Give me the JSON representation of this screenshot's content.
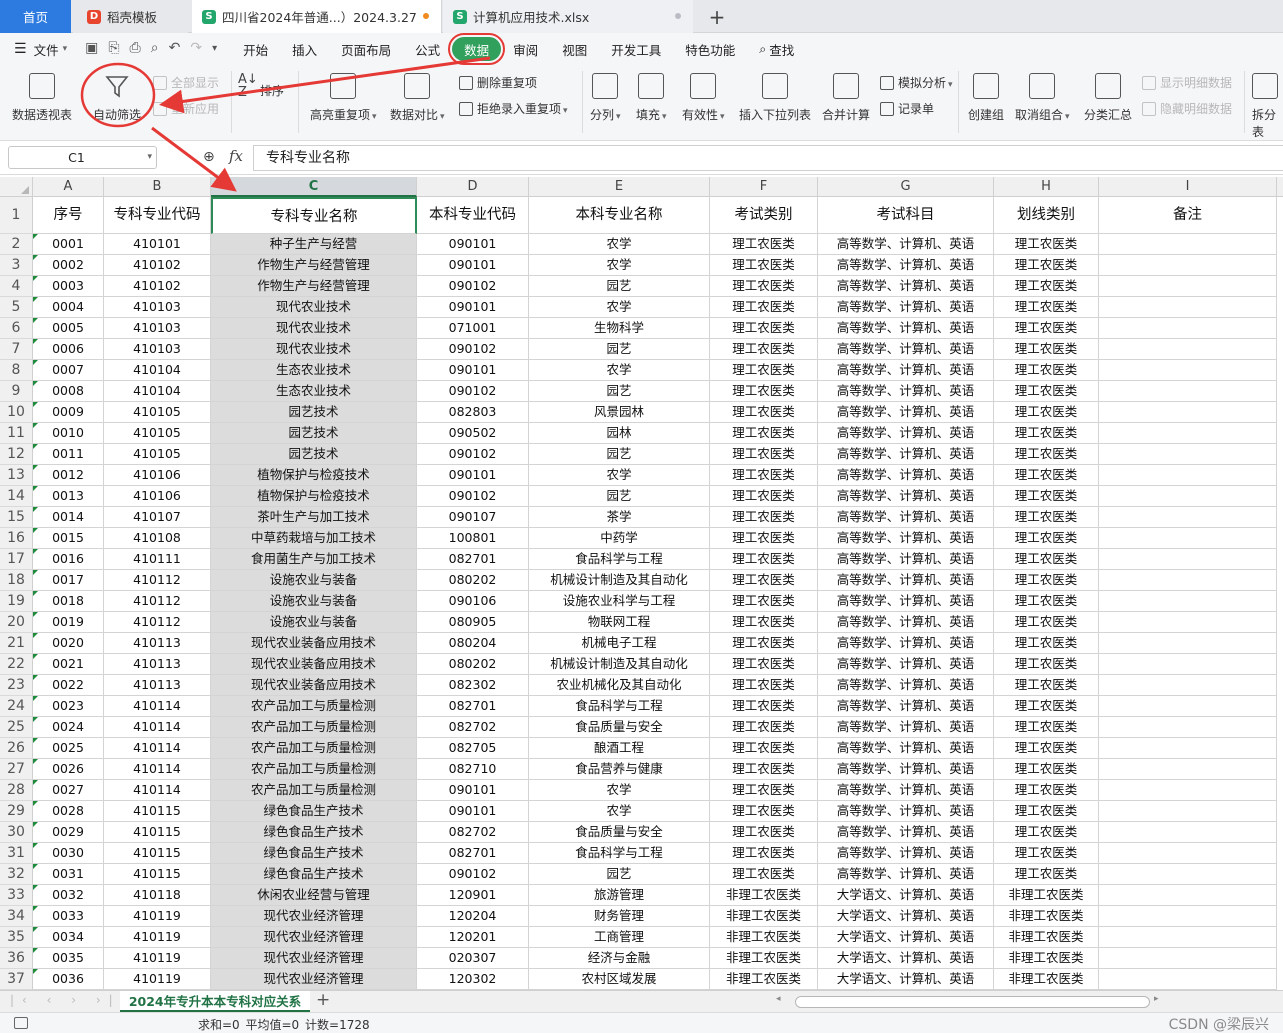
{
  "tabs": {
    "home": "首页",
    "t1": "稻壳模板",
    "t2": "四川省2024年普通...）2024.3.27",
    "t3": "计算机应用技术.xlsx",
    "plus": "+"
  },
  "menu": {
    "file": "文件",
    "tabs": [
      "开始",
      "插入",
      "页面布局",
      "公式",
      "数据",
      "审阅",
      "视图",
      "开发工具",
      "特色功能"
    ],
    "active_index": 4,
    "search": "查找"
  },
  "ribbon": {
    "pivot": "数据透视表",
    "autofilter": "自动筛选",
    "show_all": "全部显示",
    "reapply": "重新应用",
    "sort": "排序",
    "highlight_dup": "高亮重复项",
    "compare": "数据对比",
    "delete_dup": "删除重复项",
    "reject_dup": "拒绝录入重复项",
    "split": "分列",
    "fill": "填充",
    "validity": "有效性",
    "dropdown": "插入下拉列表",
    "consolidate": "合并计算",
    "simulate": "模拟分析",
    "record": "记录单",
    "group": "创建组",
    "ungroup": "取消组合",
    "subtotal": "分类汇总",
    "show_detail": "显示明细数据",
    "hide_detail": "隐藏明细数据",
    "split_table": "拆分表"
  },
  "formula_bar": {
    "name_box": "C1",
    "fx": "fx",
    "content": "专科专业名称"
  },
  "columns": [
    "A",
    "B",
    "C",
    "D",
    "E",
    "F",
    "G",
    "H",
    "I"
  ],
  "headers": [
    "序号",
    "专科专业代码",
    "专科专业名称",
    "本科专业代码",
    "本科专业名称",
    "考试类别",
    "考试科目",
    "划线类别",
    "备注"
  ],
  "rows": [
    [
      "0001",
      "410101",
      "种子生产与经营",
      "090101",
      "农学",
      "理工农医类",
      "高等数学、计算机、英语",
      "理工农医类",
      ""
    ],
    [
      "0002",
      "410102",
      "作物生产与经营管理",
      "090101",
      "农学",
      "理工农医类",
      "高等数学、计算机、英语",
      "理工农医类",
      ""
    ],
    [
      "0003",
      "410102",
      "作物生产与经营管理",
      "090102",
      "园艺",
      "理工农医类",
      "高等数学、计算机、英语",
      "理工农医类",
      ""
    ],
    [
      "0004",
      "410103",
      "现代农业技术",
      "090101",
      "农学",
      "理工农医类",
      "高等数学、计算机、英语",
      "理工农医类",
      ""
    ],
    [
      "0005",
      "410103",
      "现代农业技术",
      "071001",
      "生物科学",
      "理工农医类",
      "高等数学、计算机、英语",
      "理工农医类",
      ""
    ],
    [
      "0006",
      "410103",
      "现代农业技术",
      "090102",
      "园艺",
      "理工农医类",
      "高等数学、计算机、英语",
      "理工农医类",
      ""
    ],
    [
      "0007",
      "410104",
      "生态农业技术",
      "090101",
      "农学",
      "理工农医类",
      "高等数学、计算机、英语",
      "理工农医类",
      ""
    ],
    [
      "0008",
      "410104",
      "生态农业技术",
      "090102",
      "园艺",
      "理工农医类",
      "高等数学、计算机、英语",
      "理工农医类",
      ""
    ],
    [
      "0009",
      "410105",
      "园艺技术",
      "082803",
      "风景园林",
      "理工农医类",
      "高等数学、计算机、英语",
      "理工农医类",
      ""
    ],
    [
      "0010",
      "410105",
      "园艺技术",
      "090502",
      "园林",
      "理工农医类",
      "高等数学、计算机、英语",
      "理工农医类",
      ""
    ],
    [
      "0011",
      "410105",
      "园艺技术",
      "090102",
      "园艺",
      "理工农医类",
      "高等数学、计算机、英语",
      "理工农医类",
      ""
    ],
    [
      "0012",
      "410106",
      "植物保护与检疫技术",
      "090101",
      "农学",
      "理工农医类",
      "高等数学、计算机、英语",
      "理工农医类",
      ""
    ],
    [
      "0013",
      "410106",
      "植物保护与检疫技术",
      "090102",
      "园艺",
      "理工农医类",
      "高等数学、计算机、英语",
      "理工农医类",
      ""
    ],
    [
      "0014",
      "410107",
      "茶叶生产与加工技术",
      "090107",
      "茶学",
      "理工农医类",
      "高等数学、计算机、英语",
      "理工农医类",
      ""
    ],
    [
      "0015",
      "410108",
      "中草药栽培与加工技术",
      "100801",
      "中药学",
      "理工农医类",
      "高等数学、计算机、英语",
      "理工农医类",
      ""
    ],
    [
      "0016",
      "410111",
      "食用菌生产与加工技术",
      "082701",
      "食品科学与工程",
      "理工农医类",
      "高等数学、计算机、英语",
      "理工农医类",
      ""
    ],
    [
      "0017",
      "410112",
      "设施农业与装备",
      "080202",
      "机械设计制造及其自动化",
      "理工农医类",
      "高等数学、计算机、英语",
      "理工农医类",
      ""
    ],
    [
      "0018",
      "410112",
      "设施农业与装备",
      "090106",
      "设施农业科学与工程",
      "理工农医类",
      "高等数学、计算机、英语",
      "理工农医类",
      ""
    ],
    [
      "0019",
      "410112",
      "设施农业与装备",
      "080905",
      "物联网工程",
      "理工农医类",
      "高等数学、计算机、英语",
      "理工农医类",
      ""
    ],
    [
      "0020",
      "410113",
      "现代农业装备应用技术",
      "080204",
      "机械电子工程",
      "理工农医类",
      "高等数学、计算机、英语",
      "理工农医类",
      ""
    ],
    [
      "0021",
      "410113",
      "现代农业装备应用技术",
      "080202",
      "机械设计制造及其自动化",
      "理工农医类",
      "高等数学、计算机、英语",
      "理工农医类",
      ""
    ],
    [
      "0022",
      "410113",
      "现代农业装备应用技术",
      "082302",
      "农业机械化及其自动化",
      "理工农医类",
      "高等数学、计算机、英语",
      "理工农医类",
      ""
    ],
    [
      "0023",
      "410114",
      "农产品加工与质量检测",
      "082701",
      "食品科学与工程",
      "理工农医类",
      "高等数学、计算机、英语",
      "理工农医类",
      ""
    ],
    [
      "0024",
      "410114",
      "农产品加工与质量检测",
      "082702",
      "食品质量与安全",
      "理工农医类",
      "高等数学、计算机、英语",
      "理工农医类",
      ""
    ],
    [
      "0025",
      "410114",
      "农产品加工与质量检测",
      "082705",
      "酿酒工程",
      "理工农医类",
      "高等数学、计算机、英语",
      "理工农医类",
      ""
    ],
    [
      "0026",
      "410114",
      "农产品加工与质量检测",
      "082710",
      "食品营养与健康",
      "理工农医类",
      "高等数学、计算机、英语",
      "理工农医类",
      ""
    ],
    [
      "0027",
      "410114",
      "农产品加工与质量检测",
      "090101",
      "农学",
      "理工农医类",
      "高等数学、计算机、英语",
      "理工农医类",
      ""
    ],
    [
      "0028",
      "410115",
      "绿色食品生产技术",
      "090101",
      "农学",
      "理工农医类",
      "高等数学、计算机、英语",
      "理工农医类",
      ""
    ],
    [
      "0029",
      "410115",
      "绿色食品生产技术",
      "082702",
      "食品质量与安全",
      "理工农医类",
      "高等数学、计算机、英语",
      "理工农医类",
      ""
    ],
    [
      "0030",
      "410115",
      "绿色食品生产技术",
      "082701",
      "食品科学与工程",
      "理工农医类",
      "高等数学、计算机、英语",
      "理工农医类",
      ""
    ],
    [
      "0031",
      "410115",
      "绿色食品生产技术",
      "090102",
      "园艺",
      "理工农医类",
      "高等数学、计算机、英语",
      "理工农医类",
      ""
    ],
    [
      "0032",
      "410118",
      "休闲农业经营与管理",
      "120901",
      "旅游管理",
      "非理工农医类",
      "大学语文、计算机、英语",
      "非理工农医类",
      ""
    ],
    [
      "0033",
      "410119",
      "现代农业经济管理",
      "120204",
      "财务管理",
      "非理工农医类",
      "大学语文、计算机、英语",
      "非理工农医类",
      ""
    ],
    [
      "0034",
      "410119",
      "现代农业经济管理",
      "120201",
      "工商管理",
      "非理工农医类",
      "大学语文、计算机、英语",
      "非理工农医类",
      ""
    ],
    [
      "0035",
      "410119",
      "现代农业经济管理",
      "020307",
      "经济与金融",
      "非理工农医类",
      "大学语文、计算机、英语",
      "非理工农医类",
      ""
    ],
    [
      "0036",
      "410119",
      "现代农业经济管理",
      "120302",
      "农村区域发展",
      "非理工农医类",
      "大学语文、计算机、英语",
      "非理工农医类",
      ""
    ]
  ],
  "sheet": {
    "tab": "2024年专升本本专科对应关系",
    "add": "+"
  },
  "status": {
    "stats": "求和=0  平均值=0  计数=1728",
    "watermark": "CSDN @梁辰兴"
  },
  "colors": {
    "accent": "#2d7be0",
    "active_tab": "#31a05c",
    "annotation": "#e53935",
    "selection": "#217346"
  }
}
